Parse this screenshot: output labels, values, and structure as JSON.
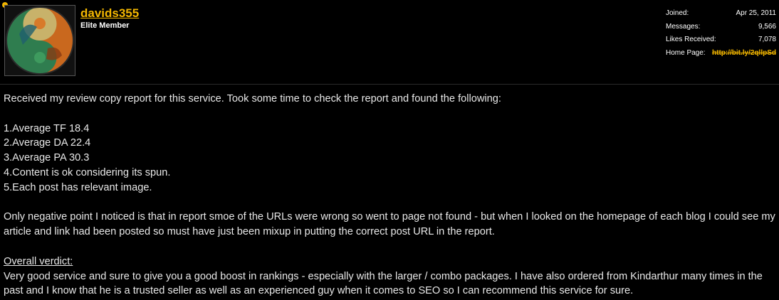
{
  "user": {
    "username": "davids355",
    "title": "Elite Member"
  },
  "stats": [
    {
      "label": "Joined:",
      "value": "Apr 25, 2011"
    },
    {
      "label": "Messages:",
      "value": "9,566"
    },
    {
      "label": "Likes Received:",
      "value": "7,078"
    }
  ],
  "homepage": {
    "label": "Home Page:",
    "url": "http://bit.ly/2qllpSd"
  },
  "post": {
    "intro": "Received my review copy report for this service. Took some time to check the report and found the following:",
    "points": [
      "1.Average TF 18.4",
      "2.Average DA 22.4",
      "3.Average PA 30.3",
      "4.Content is ok considering its spun.",
      "5.Each post has relevant image."
    ],
    "negative": "Only negative point I noticed is that in report smoe of the URLs were wrong so went to page not found - but when I looked on the homepage of each blog I could see my article and link had been posted so must have just been mixup in putting the correct post URL in the report.",
    "verdict_heading": "Overall verdict:",
    "verdict_text": "Very good service and sure to give you a good boost in rankings - especially with the larger / combo packages. I have also ordered from Kindarthur many times in the past and I know that he is a trusted seller as well as an experienced guy when it comes to SEO so I can recommend this service for sure."
  },
  "colors": {
    "accent": "#f5b800",
    "background": "#000000"
  }
}
